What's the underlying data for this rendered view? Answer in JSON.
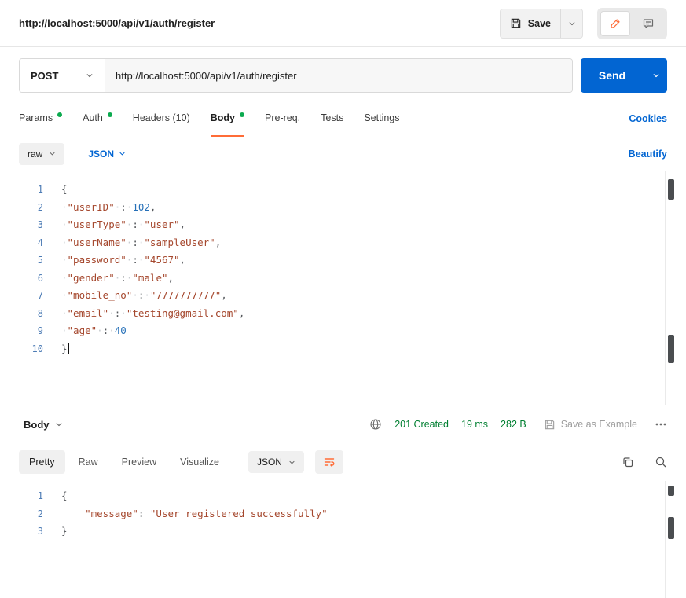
{
  "header": {
    "title": "http://localhost:5000/api/v1/auth/register",
    "save_label": "Save"
  },
  "request": {
    "method": "POST",
    "url": "http://localhost:5000/api/v1/auth/register",
    "send_label": "Send"
  },
  "request_tabs": [
    {
      "label": "Params",
      "dot": true
    },
    {
      "label": "Auth",
      "dot": true
    },
    {
      "label": "Headers (10)",
      "dot": false
    },
    {
      "label": "Body",
      "dot": true,
      "active": true
    },
    {
      "label": "Pre-req.",
      "dot": false
    },
    {
      "label": "Tests",
      "dot": false
    },
    {
      "label": "Settings",
      "dot": false
    }
  ],
  "cookies_label": "Cookies",
  "body_toolbar": {
    "format": "raw",
    "language": "JSON",
    "beautify_label": "Beautify"
  },
  "request_editor": {
    "cursor_line": 10,
    "lines": [
      [
        [
          "p",
          "{"
        ]
      ],
      [
        [
          "w",
          "·"
        ],
        [
          "k",
          "\"userID\""
        ],
        [
          "w",
          "·"
        ],
        [
          "p",
          ":"
        ],
        [
          "w",
          "·"
        ],
        [
          "n",
          "102"
        ],
        [
          "p",
          ","
        ]
      ],
      [
        [
          "w",
          "·"
        ],
        [
          "k",
          "\"userType\""
        ],
        [
          "w",
          "·"
        ],
        [
          "p",
          ":"
        ],
        [
          "w",
          "·"
        ],
        [
          "s",
          "\"user\""
        ],
        [
          "p",
          ","
        ]
      ],
      [
        [
          "w",
          "·"
        ],
        [
          "k",
          "\"userName\""
        ],
        [
          "w",
          "·"
        ],
        [
          "p",
          ":"
        ],
        [
          "w",
          "·"
        ],
        [
          "s",
          "\"sampleUser\""
        ],
        [
          "p",
          ","
        ]
      ],
      [
        [
          "w",
          "·"
        ],
        [
          "k",
          "\"password\""
        ],
        [
          "w",
          "·"
        ],
        [
          "p",
          ":"
        ],
        [
          "w",
          "·"
        ],
        [
          "s",
          "\"4567\""
        ],
        [
          "p",
          ","
        ]
      ],
      [
        [
          "w",
          "·"
        ],
        [
          "k",
          "\"gender\""
        ],
        [
          "w",
          "·"
        ],
        [
          "p",
          ":"
        ],
        [
          "w",
          "·"
        ],
        [
          "s",
          "\"male\""
        ],
        [
          "p",
          ","
        ]
      ],
      [
        [
          "w",
          "·"
        ],
        [
          "k",
          "\"mobile_no\""
        ],
        [
          "w",
          "·"
        ],
        [
          "p",
          ":"
        ],
        [
          "w",
          "·"
        ],
        [
          "s",
          "\"7777777777\""
        ],
        [
          "p",
          ","
        ]
      ],
      [
        [
          "w",
          "·"
        ],
        [
          "k",
          "\"email\""
        ],
        [
          "w",
          "·"
        ],
        [
          "p",
          ":"
        ],
        [
          "w",
          "·"
        ],
        [
          "s",
          "\"testing@gmail.com\""
        ],
        [
          "p",
          ","
        ]
      ],
      [
        [
          "w",
          "·"
        ],
        [
          "k",
          "\"age\""
        ],
        [
          "w",
          "·"
        ],
        [
          "p",
          ":"
        ],
        [
          "w",
          "·"
        ],
        [
          "n",
          "40"
        ]
      ],
      [
        [
          "p",
          "}"
        ]
      ]
    ]
  },
  "response": {
    "body_label": "Body",
    "status": "201 Created",
    "time": "19 ms",
    "size": "282 B",
    "save_as_example_label": "Save as Example",
    "tabs": [
      "Pretty",
      "Raw",
      "Preview",
      "Visualize"
    ],
    "language": "JSON",
    "editor": {
      "lines": [
        [
          [
            "p",
            "{"
          ]
        ],
        [
          [
            "w",
            "    "
          ],
          [
            "k",
            "\"message\""
          ],
          [
            "p",
            ":"
          ],
          [
            "w",
            " "
          ],
          [
            "s",
            "\"User registered successfully\""
          ]
        ],
        [
          [
            "p",
            "}"
          ]
        ]
      ]
    }
  },
  "icons": {
    "save": "floppy-disk",
    "chevron": "chevron-down",
    "edit": "pencil",
    "comment": "speech-bubble",
    "network": "globe",
    "more": "ellipsis-horizontal",
    "copy": "overlapping-squares",
    "search": "magnifier",
    "wrap": "text-wrap"
  },
  "colors": {
    "accent_orange": "#FF6C37",
    "link_blue": "#0265D2",
    "send_blue": "#0265D2",
    "status_green": "#007F31",
    "tab_dot_green": "#0CAA4F",
    "code_key": "#A5472D",
    "code_string": "#A5472D",
    "code_number": "#2670B8",
    "line_number_blue": "#4D7CB5"
  }
}
